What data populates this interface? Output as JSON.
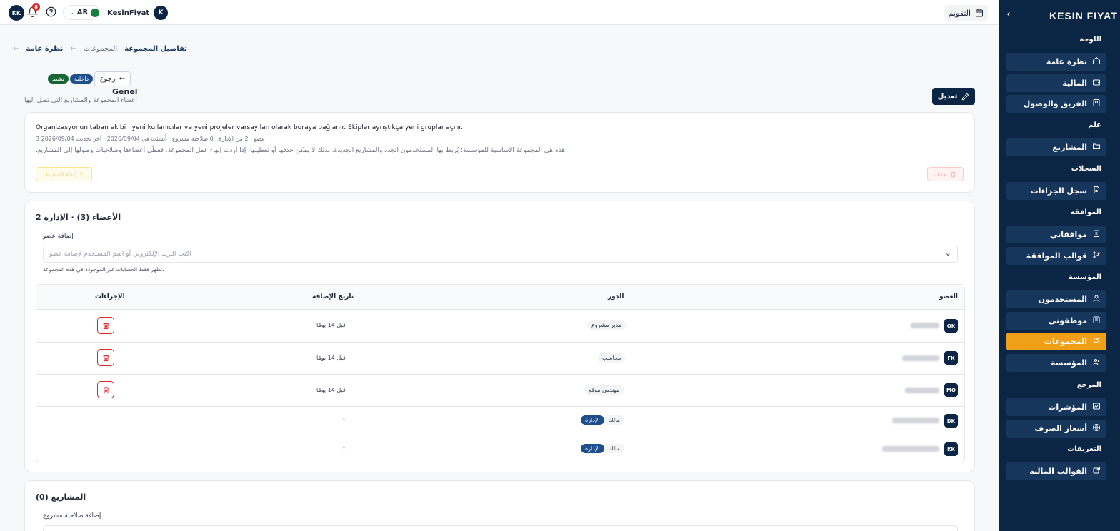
{
  "brand": {
    "logo": "KESIN FIYAT"
  },
  "topbar": {
    "calendar_label": "التقويم",
    "user_initial": "K",
    "user_name": "KesinFiyat",
    "language": "AR",
    "notifications_count": "8",
    "avatar_initials": "KK"
  },
  "sidebar": {
    "sections": [
      {
        "label": "اللوحة",
        "items": [
          {
            "label": "نظرة عامة",
            "icon": "home-icon"
          },
          {
            "label": "المالية",
            "icon": "wallet-icon"
          },
          {
            "label": "الفريق والوصول",
            "icon": "team-icon"
          }
        ]
      },
      {
        "label": "علم",
        "items": [
          {
            "label": "المشاريع",
            "icon": "folder-icon"
          }
        ]
      },
      {
        "label": "السجلات",
        "items": [
          {
            "label": "سجل الجزاءات",
            "icon": "document-icon"
          }
        ]
      },
      {
        "label": "الموافقة",
        "items": [
          {
            "label": "موافقاتي",
            "icon": "clipboard-icon"
          },
          {
            "label": "قوالب الموافقة",
            "icon": "branch-icon"
          }
        ]
      },
      {
        "label": "المؤسسة",
        "items": [
          {
            "label": "المستخدمون",
            "icon": "user-icon"
          },
          {
            "label": "موظفوني",
            "icon": "employee-icon"
          },
          {
            "label": "المجموعات",
            "icon": "group-icon",
            "active": true
          },
          {
            "label": "المؤسسة",
            "icon": "organization-icon"
          }
        ]
      },
      {
        "label": "المرجع",
        "items": [
          {
            "label": "المؤشرات",
            "icon": "chart-icon"
          },
          {
            "label": "أسعار الصرف",
            "icon": "globe-icon"
          }
        ]
      },
      {
        "label": "التعريفات",
        "items": [
          {
            "label": "القوالب المالية",
            "icon": "external-icon"
          }
        ]
      }
    ]
  },
  "breadcrumb": {
    "first": "نظرة عامة",
    "second": "المجموعات",
    "third": "تفاصيل المجموعة"
  },
  "header": {
    "back_label": "رجوع",
    "badge_internal": "داخلية",
    "badge_active": "نشط",
    "title": "Genel",
    "subtitle": "أعضاء المجموعة والمشاريع التي تصل إليها",
    "edit_label": "تعديل"
  },
  "info": {
    "description": "Organizasyonun taban ekibi · yeni kullanıcılar ve yeni projeler varsayılan olarak buraya bağlanır. Ekipler ayrıştıkça yeni gruplar açılır.",
    "meta": "عضو · 2 من الإدارة · 0 صلاحية مشروع · أُنشئت في 2026/09/04 · آخر تحديث 2026/09/04 3",
    "note": "هذه هي المجموعة الأساسية للمؤسسة؛ يُربط بها المستخدمون الجدد والمشاريع الجديدة. لذلك لا يمكن حذفها أو تعطيلها. إذا أردت إنهاء عمل المجموعة، فعطّل أعضاءها وصلاحيات وصولها إلى المشاريع.",
    "delete_label": "حذف",
    "disable_label": "إلغاء التنشيط"
  },
  "members": {
    "title": "الأعضاء (3) · الإدارة 2",
    "add_label": "إضافة عضو",
    "add_placeholder": "اكتب البريد الإلكتروني أو اسم المستخدم لإضافة عضو",
    "hint": "تظهر فقط الحسابات غير الموجودة في هذه المجموعة.",
    "columns": {
      "member": "العضو",
      "role": "الدور",
      "added": "تاريخ الإضافة",
      "actions": "الإجراءات"
    },
    "rows": [
      {
        "initials": "QK",
        "role": "مدير مشروع",
        "admin_badge": "",
        "added": "قبل 14 يومًا",
        "deletable": true
      },
      {
        "initials": "FK",
        "role": "محاسب",
        "admin_badge": "",
        "added": "قبل 14 يومًا",
        "deletable": true
      },
      {
        "initials": "MO",
        "role": "مهندس موقع",
        "admin_badge": "",
        "added": "قبل 14 يومًا",
        "deletable": true
      },
      {
        "initials": "DK",
        "role": "مالك",
        "admin_badge": "الإدارة",
        "added": "-",
        "deletable": false
      },
      {
        "initials": "KK",
        "role": "مالك",
        "admin_badge": "الإدارة",
        "added": "-",
        "deletable": false
      }
    ]
  },
  "projects": {
    "title": "المشاريع (0)",
    "add_label": "إضافة صلاحية مشروع"
  },
  "colors": {
    "navy": "#0b2545",
    "nav_item": "#16365c",
    "active": "#f0a017",
    "danger": "#dc2626",
    "badge_blue": "#1e4e8c",
    "badge_green": "#166534"
  }
}
